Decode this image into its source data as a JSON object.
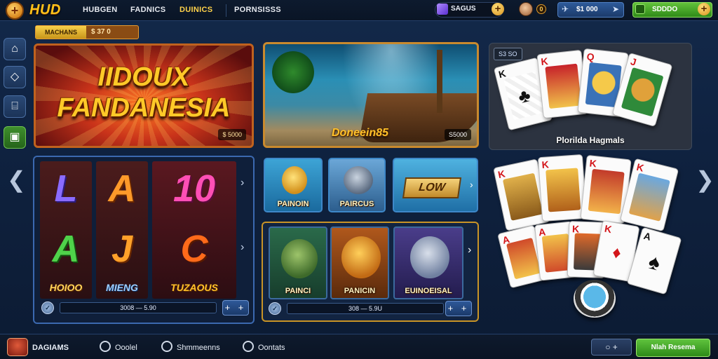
{
  "header": {
    "logo_text": "HUD",
    "nav": [
      "HUBGEN",
      "FADNICS",
      "DUINICS",
      "PORNSISSS"
    ],
    "coins_label": "SAGUS",
    "notif_count": "0",
    "balance": "$1 000",
    "deposit_label": "SDDDO"
  },
  "tag": {
    "left": "MACHANS",
    "right": "$ 37  0"
  },
  "banners": {
    "red": {
      "line1": "IIDOUX",
      "line2": "FANDANESIA",
      "chip": "$ 5000"
    },
    "sea": {
      "title": "Doneein85",
      "chip": "S5000"
    },
    "cards": {
      "pill": "S3 SO",
      "caption": "Plorilda Hagmals"
    }
  },
  "slot": {
    "symbols": [
      "L",
      "A",
      "10",
      "A",
      "J",
      "C"
    ],
    "names": [
      "HOIOO",
      "MIENG",
      "TUZAOUS"
    ],
    "bar_text": "3008 — 5.90",
    "bar_btn": "+ +"
  },
  "tiles_small": [
    {
      "label": "PAINOIN"
    },
    {
      "label": "PAIRCUS"
    },
    {
      "label": "LOW"
    }
  ],
  "tiles_big": [
    {
      "label": "PAINCI"
    },
    {
      "label": "PANICIN"
    },
    {
      "label": "EUINOEISAL"
    }
  ],
  "mid_bar": {
    "text": "308 — 5.9U",
    "btn": "+ +"
  },
  "footer": {
    "brand": "DAGIAMS",
    "items": [
      "Ooolel",
      "Shmmeenns",
      "Oontats"
    ],
    "toggle": "○ +",
    "cta": "Nlah Resema"
  },
  "colors": {
    "accent_gold": "#ffc21a",
    "cta_green": "#5fc33d",
    "panel_blue": "#3b69b0"
  }
}
